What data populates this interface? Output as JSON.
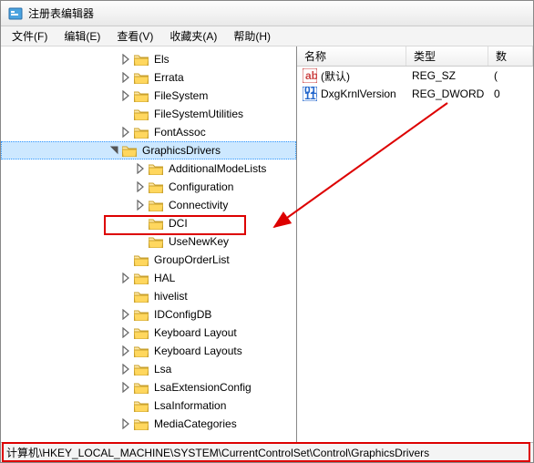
{
  "window": {
    "title": "注册表编辑器"
  },
  "menu": {
    "file": "文件(F)",
    "edit": "编辑(E)",
    "view": "查看(V)",
    "favorites": "收藏夹(A)",
    "help": "帮助(H)"
  },
  "tree": [
    {
      "label": "Els",
      "indent": 132,
      "expander": "closed"
    },
    {
      "label": "Errata",
      "indent": 132,
      "expander": "closed"
    },
    {
      "label": "FileSystem",
      "indent": 132,
      "expander": "closed"
    },
    {
      "label": "FileSystemUtilities",
      "indent": 132,
      "expander": "none"
    },
    {
      "label": "FontAssoc",
      "indent": 132,
      "expander": "closed"
    },
    {
      "label": "GraphicsDrivers",
      "indent": 118,
      "expander": "open",
      "selected": true
    },
    {
      "label": "AdditionalModeLists",
      "indent": 148,
      "expander": "closed"
    },
    {
      "label": "Configuration",
      "indent": 148,
      "expander": "closed"
    },
    {
      "label": "Connectivity",
      "indent": 148,
      "expander": "closed"
    },
    {
      "label": "DCI",
      "indent": 148,
      "expander": "none",
      "highlight": true
    },
    {
      "label": "UseNewKey",
      "indent": 148,
      "expander": "none"
    },
    {
      "label": "GroupOrderList",
      "indent": 132,
      "expander": "none"
    },
    {
      "label": "HAL",
      "indent": 132,
      "expander": "closed"
    },
    {
      "label": "hivelist",
      "indent": 132,
      "expander": "none"
    },
    {
      "label": "IDConfigDB",
      "indent": 132,
      "expander": "closed"
    },
    {
      "label": "Keyboard Layout",
      "indent": 132,
      "expander": "closed"
    },
    {
      "label": "Keyboard Layouts",
      "indent": 132,
      "expander": "closed"
    },
    {
      "label": "Lsa",
      "indent": 132,
      "expander": "closed"
    },
    {
      "label": "LsaExtensionConfig",
      "indent": 132,
      "expander": "closed"
    },
    {
      "label": "LsaInformation",
      "indent": 132,
      "expander": "none"
    },
    {
      "label": "MediaCategories",
      "indent": 132,
      "expander": "closed"
    }
  ],
  "list": {
    "headers": {
      "name": "名称",
      "type": "类型",
      "data": "数"
    },
    "rows": [
      {
        "icon": "string",
        "name": "(默认)",
        "type": "REG_SZ",
        "data": "("
      },
      {
        "icon": "dword",
        "name": "DxgKrnlVersion",
        "type": "REG_DWORD",
        "data": "0"
      }
    ]
  },
  "statusbar": {
    "path": "计算机\\HKEY_LOCAL_MACHINE\\SYSTEM\\CurrentControlSet\\Control\\GraphicsDrivers"
  }
}
